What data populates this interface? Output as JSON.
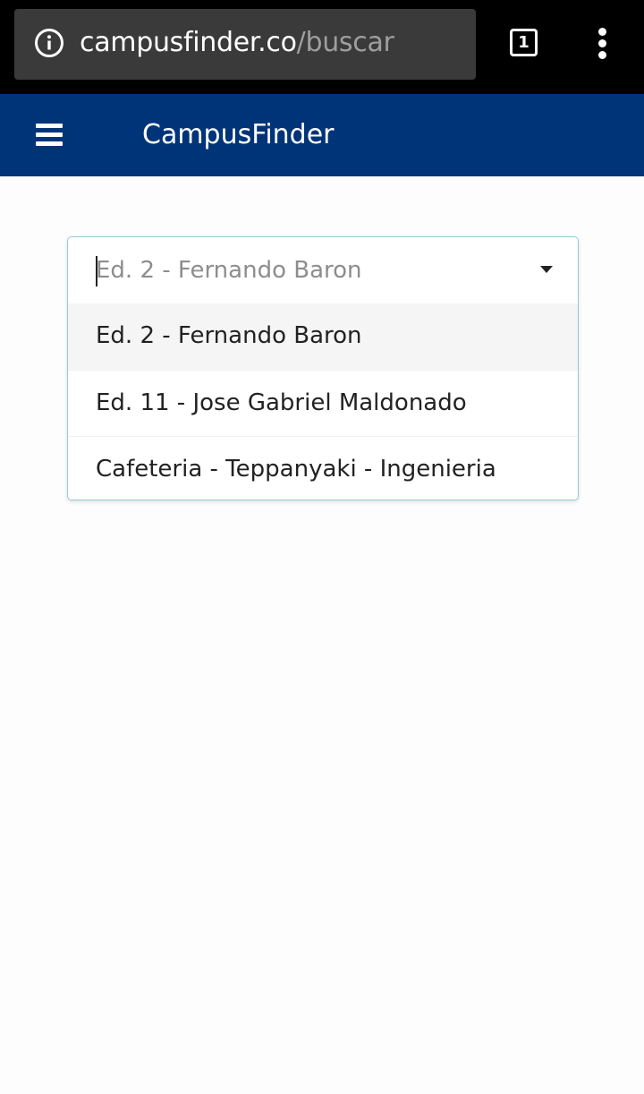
{
  "browser": {
    "url_domain": "campusfinder.co",
    "url_path": "/buscar",
    "tab_count": "1",
    "icons": {
      "info": "info-icon",
      "tabs": "tabs-icon",
      "menu": "more-vert-icon"
    }
  },
  "header": {
    "menu_icon": "hamburger-icon",
    "title": "CampusFinder",
    "background_color": "#003478"
  },
  "search": {
    "placeholder": "Ed. 2 - Fernando Baron",
    "expanded": true,
    "options": [
      {
        "label": "Ed. 2 - Fernando Baron",
        "selected": true
      },
      {
        "label": "Ed. 11 - Jose Gabriel Maldonado",
        "selected": false
      },
      {
        "label": "Cafeteria - Teppanyaki - Ingenieria",
        "selected": false
      }
    ]
  }
}
